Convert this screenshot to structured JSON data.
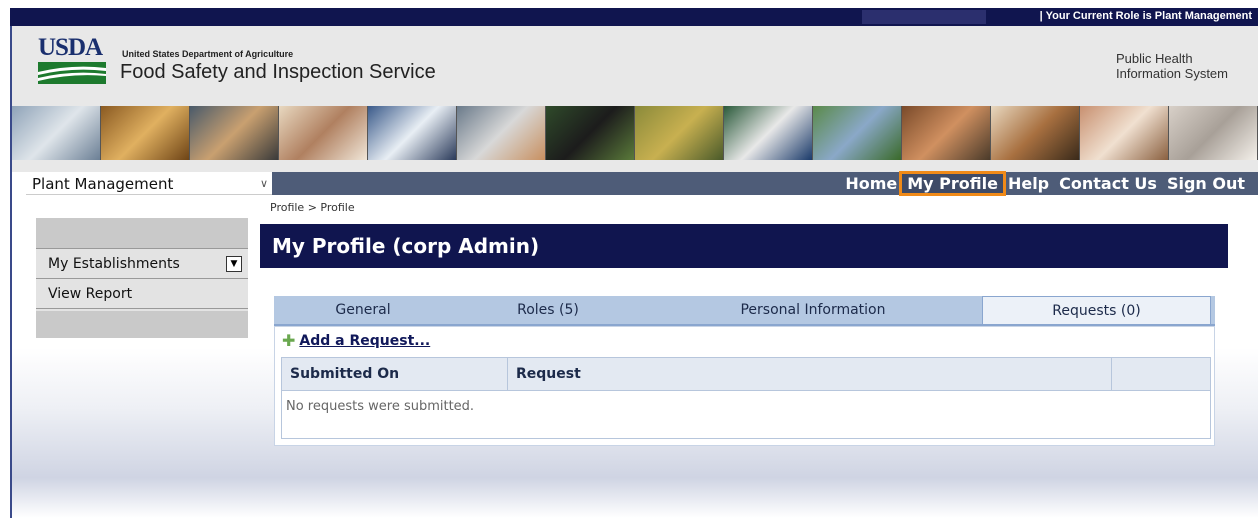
{
  "role_banner": "| Your Current Role is Plant Management",
  "header": {
    "logo_text": "USDA",
    "department": "United States Department of Agriculture",
    "agency": "Food Safety and Inspection Service",
    "system_line1": "Public Health",
    "system_line2": "Information System"
  },
  "role_select": {
    "value": "Plant Management"
  },
  "nav": {
    "home": "Home",
    "my_profile": "My Profile",
    "help": "Help",
    "contact_us": "Contact Us",
    "sign_out": "Sign Out"
  },
  "sidebar": {
    "items": [
      {
        "label": "My Establishments"
      },
      {
        "label": "View Report"
      }
    ]
  },
  "breadcrumb": "Profile > Profile",
  "page_title": "My Profile (corp Admin)",
  "tabs": [
    {
      "label": "General"
    },
    {
      "label": "Roles (5)"
    },
    {
      "label": "Personal Information"
    },
    {
      "label": "Requests (0)"
    }
  ],
  "requests": {
    "add_label": "Add a Request...",
    "columns": [
      "Submitted On",
      "Request",
      ""
    ],
    "empty_message": "No requests were submitted."
  },
  "colors": {
    "navy": "#10154f",
    "nav_bar": "#4e5c78",
    "highlight": "#f08a18",
    "tab_bar": "#b4c8e2"
  }
}
